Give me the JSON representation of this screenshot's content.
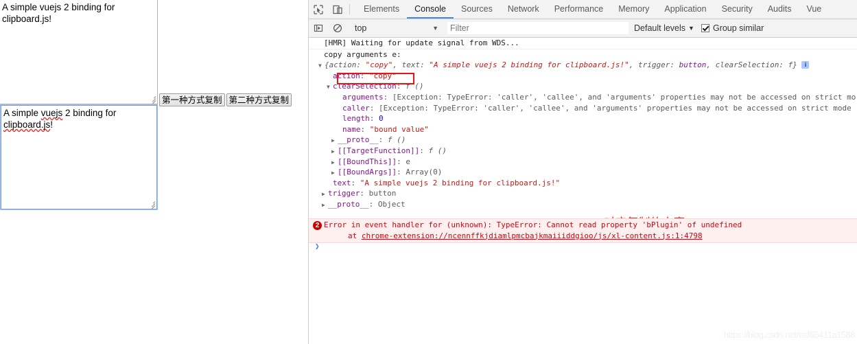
{
  "page": {
    "textarea_top": {
      "value": "A simple vuejs 2 binding for clipboard.js!"
    },
    "textarea_bottom": {
      "value_line1": "A simple ",
      "value_misspelled1": "vuejs",
      "value_mid": " 2 binding for ",
      "value_misspelled2": "clipboard.js",
      "value_end": "!"
    },
    "buttons": [
      {
        "label": "第一种方式复制"
      },
      {
        "label": "第二种方式复制"
      }
    ]
  },
  "devtools": {
    "icons": {
      "inspect": "inspect-element-icon",
      "device": "device-toolbar-icon",
      "execution_context": "execution-context-icon",
      "clear": "clear-console-icon"
    },
    "tabs": [
      {
        "label": "Elements",
        "active": false
      },
      {
        "label": "Console",
        "active": true
      },
      {
        "label": "Sources",
        "active": false
      },
      {
        "label": "Network",
        "active": false
      },
      {
        "label": "Performance",
        "active": false
      },
      {
        "label": "Memory",
        "active": false
      },
      {
        "label": "Application",
        "active": false
      },
      {
        "label": "Security",
        "active": false
      },
      {
        "label": "Audits",
        "active": false
      },
      {
        "label": "Vue",
        "active": false
      }
    ],
    "filterbar": {
      "context": "top",
      "context_caret": "▼",
      "filter_placeholder": "Filter",
      "filter_value": "",
      "levels_label": "Default levels",
      "levels_caret": "▼",
      "group_similar_label": "Group similar",
      "group_similar_checked": true
    },
    "console": {
      "rows": [
        {
          "text": "[HMR] Waiting for update signal from WDS..."
        },
        {
          "text": "copy arguments e:"
        }
      ],
      "object_preview": {
        "triangle": "▼",
        "open": "{",
        "p1_key": "action: ",
        "p1_val": "\"copy\"",
        "p2_key": ", text: ",
        "p2_val": "\"A simple vuejs 2 binding for clipboard.js!\"",
        "p3_key": ", trigger: ",
        "p3_val": "button",
        "p4_key": ", clearSelection: ",
        "p4_val": "f",
        "close": "}",
        "info_badge": "i"
      },
      "props": [
        {
          "indent": 1,
          "tri": "",
          "name": "action",
          "sep": ": ",
          "value": "\"copy\"",
          "vclass": "k-str",
          "highlight": true
        },
        {
          "indent": 1,
          "tri": "▼",
          "name": "clearSelection",
          "sep": ": ",
          "value": "f ()",
          "vclass": "k-fn",
          "highlight": false
        },
        {
          "indent": 2,
          "tri": "",
          "name": "arguments",
          "sep": ": ",
          "value": "[Exception: TypeError: 'caller', 'callee', and 'arguments' properties may not be accessed on strict mo",
          "vclass": "k-dim",
          "highlight": false
        },
        {
          "indent": 2,
          "tri": "",
          "name": "caller",
          "sep": ": ",
          "value": "[Exception: TypeError: 'caller', 'callee', and 'arguments' properties may not be accessed on strict mode",
          "vclass": "k-dim",
          "highlight": false
        },
        {
          "indent": 2,
          "tri": "",
          "name": "length",
          "sep": ": ",
          "value": "0",
          "vclass": "k-num",
          "highlight": false
        },
        {
          "indent": 2,
          "tri": "",
          "name": "name",
          "sep": ": ",
          "value": "\"bound value\"",
          "vclass": "k-str",
          "highlight": false
        },
        {
          "indent": 2,
          "tri": "▶",
          "name": "__proto__",
          "sep": ": ",
          "value": "f ()",
          "vclass": "k-fn",
          "highlight": false
        },
        {
          "indent": 2,
          "tri": "▶",
          "name": "[[TargetFunction]]",
          "sep": ": ",
          "value": "f ()",
          "vclass": "k-fn",
          "highlight": false
        },
        {
          "indent": 2,
          "tri": "▶",
          "name": "[[BoundThis]]",
          "sep": ": ",
          "value": "e",
          "vclass": "k-dim",
          "highlight": false
        },
        {
          "indent": 2,
          "tri": "▶",
          "name": "[[BoundArgs]]",
          "sep": ": ",
          "value": "Array(0)",
          "vclass": "k-dim",
          "highlight": false
        },
        {
          "indent": 1,
          "tri": "",
          "name": "text",
          "sep": ": ",
          "value": "\"A simple vuejs 2 binding for clipboard.js!\"",
          "vclass": "k-str",
          "highlight": true
        },
        {
          "indent": 1,
          "tri": "▶",
          "name": "trigger",
          "sep": ": ",
          "value": "button",
          "vclass": "k-dim",
          "highlight": false
        },
        {
          "indent": 1,
          "tri": "▶",
          "name": "__proto__",
          "sep": ": ",
          "value": "Object",
          "vclass": "k-dim",
          "highlight": false
        }
      ],
      "annotation": "text对应复制的内容",
      "annotation_color": "#ff2020",
      "error": {
        "count": "2",
        "line1": "Error in event handler for (unknown): TypeError: Cannot read property 'bPlugin' of undefined",
        "line2_prefix": "at ",
        "line2_link": "chrome-extension://ncennffkjdiamlpmcbajkmaiiiddgioo/js/xl-content.js:1:4798"
      },
      "prompt_chevron": "❯"
    }
  },
  "watermark": "https://blog.csdn.net/nsf65411a1588",
  "colors": {
    "accent_tab": "#4285f4",
    "highlight_box": "#ee1111",
    "annotation": "#ff2020",
    "error_bg": "#fff0f0",
    "error_text": "#d8000c",
    "string": "#c41a16",
    "property": "#881391"
  }
}
